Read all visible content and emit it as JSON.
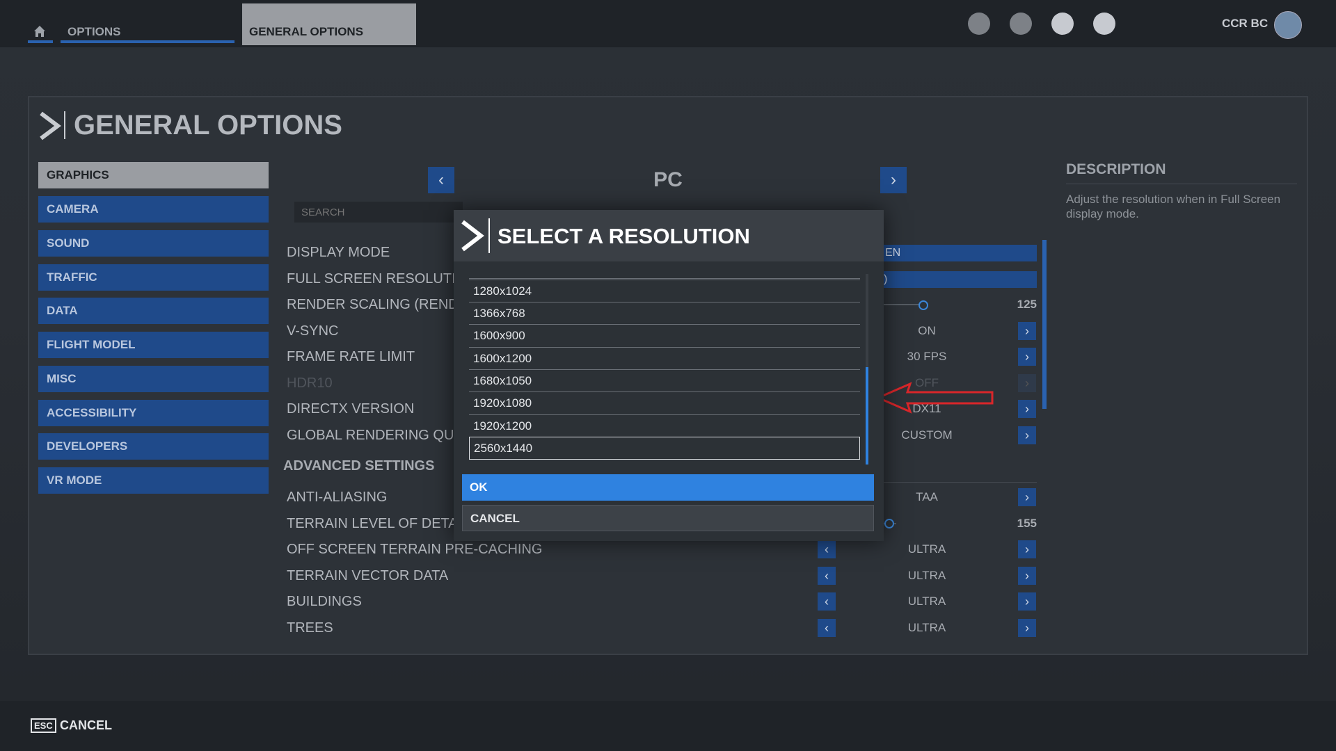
{
  "topbar": {
    "options_tab": "OPTIONS",
    "general_tab": "GENERAL OPTIONS",
    "user_name": "CCR BC",
    "icons": [
      "home-icon",
      "speedometer-icon",
      "friends-icon",
      "profile-icon",
      "notification-icon"
    ]
  },
  "page": {
    "title": "GENERAL OPTIONS"
  },
  "sidebar": {
    "items": [
      "GRAPHICS",
      "CAMERA",
      "SOUND",
      "TRAFFIC",
      "DATA",
      "FLIGHT MODEL",
      "MISC",
      "ACCESSIBILITY",
      "DEVELOPERS",
      "VR MODE"
    ]
  },
  "platform": {
    "label": "PC",
    "search_placeholder": "SEARCH"
  },
  "settings": {
    "rows": [
      {
        "label": "DISPLAY MODE",
        "value": "EN"
      },
      {
        "label": "FULL SCREEN RESOLUTI",
        "value": ")"
      },
      {
        "label": "RENDER SCALING (REND",
        "value": "125"
      },
      {
        "label": "V-SYNC",
        "value": "ON"
      },
      {
        "label": "FRAME RATE LIMIT",
        "value": "30 FPS"
      },
      {
        "label": "HDR10",
        "value": "OFF"
      },
      {
        "label": "DIRECTX VERSION",
        "value": "DX11"
      },
      {
        "label": "GLOBAL RENDERING QU",
        "value": "CUSTOM"
      }
    ],
    "advanced_title": "ADVANCED SETTINGS",
    "advanced": [
      {
        "label": "ANTI-ALIASING",
        "value": "TAA"
      },
      {
        "label": "TERRAIN LEVEL OF DETA",
        "value": "155"
      },
      {
        "label": "OFF SCREEN TERRAIN PRE-CACHING",
        "value": "ULTRA"
      },
      {
        "label": "TERRAIN VECTOR DATA",
        "value": "ULTRA"
      },
      {
        "label": "BUILDINGS",
        "value": "ULTRA"
      },
      {
        "label": "TREES",
        "value": "ULTRA"
      }
    ],
    "render_scaling_level": 125,
    "terrain_lod_level": 155
  },
  "description": {
    "title": "DESCRIPTION",
    "text": "Adjust the resolution when in Full Screen display mode."
  },
  "dialog": {
    "title": "SELECT A RESOLUTION",
    "options": [
      "1280x1024",
      "1366x768",
      "1600x900",
      "1600x1200",
      "1680x1050",
      "1920x1080",
      "1920x1200",
      "2560x1440"
    ],
    "selected": "2560x1440",
    "ok": "OK",
    "cancel": "CANCEL"
  },
  "footer": {
    "esc_key": "ESC",
    "cancel": "CANCEL"
  },
  "colors": {
    "accent_blue": "#2f82e0",
    "nav_blue": "#1f4a8a",
    "arrow_red": "#d9262a"
  }
}
